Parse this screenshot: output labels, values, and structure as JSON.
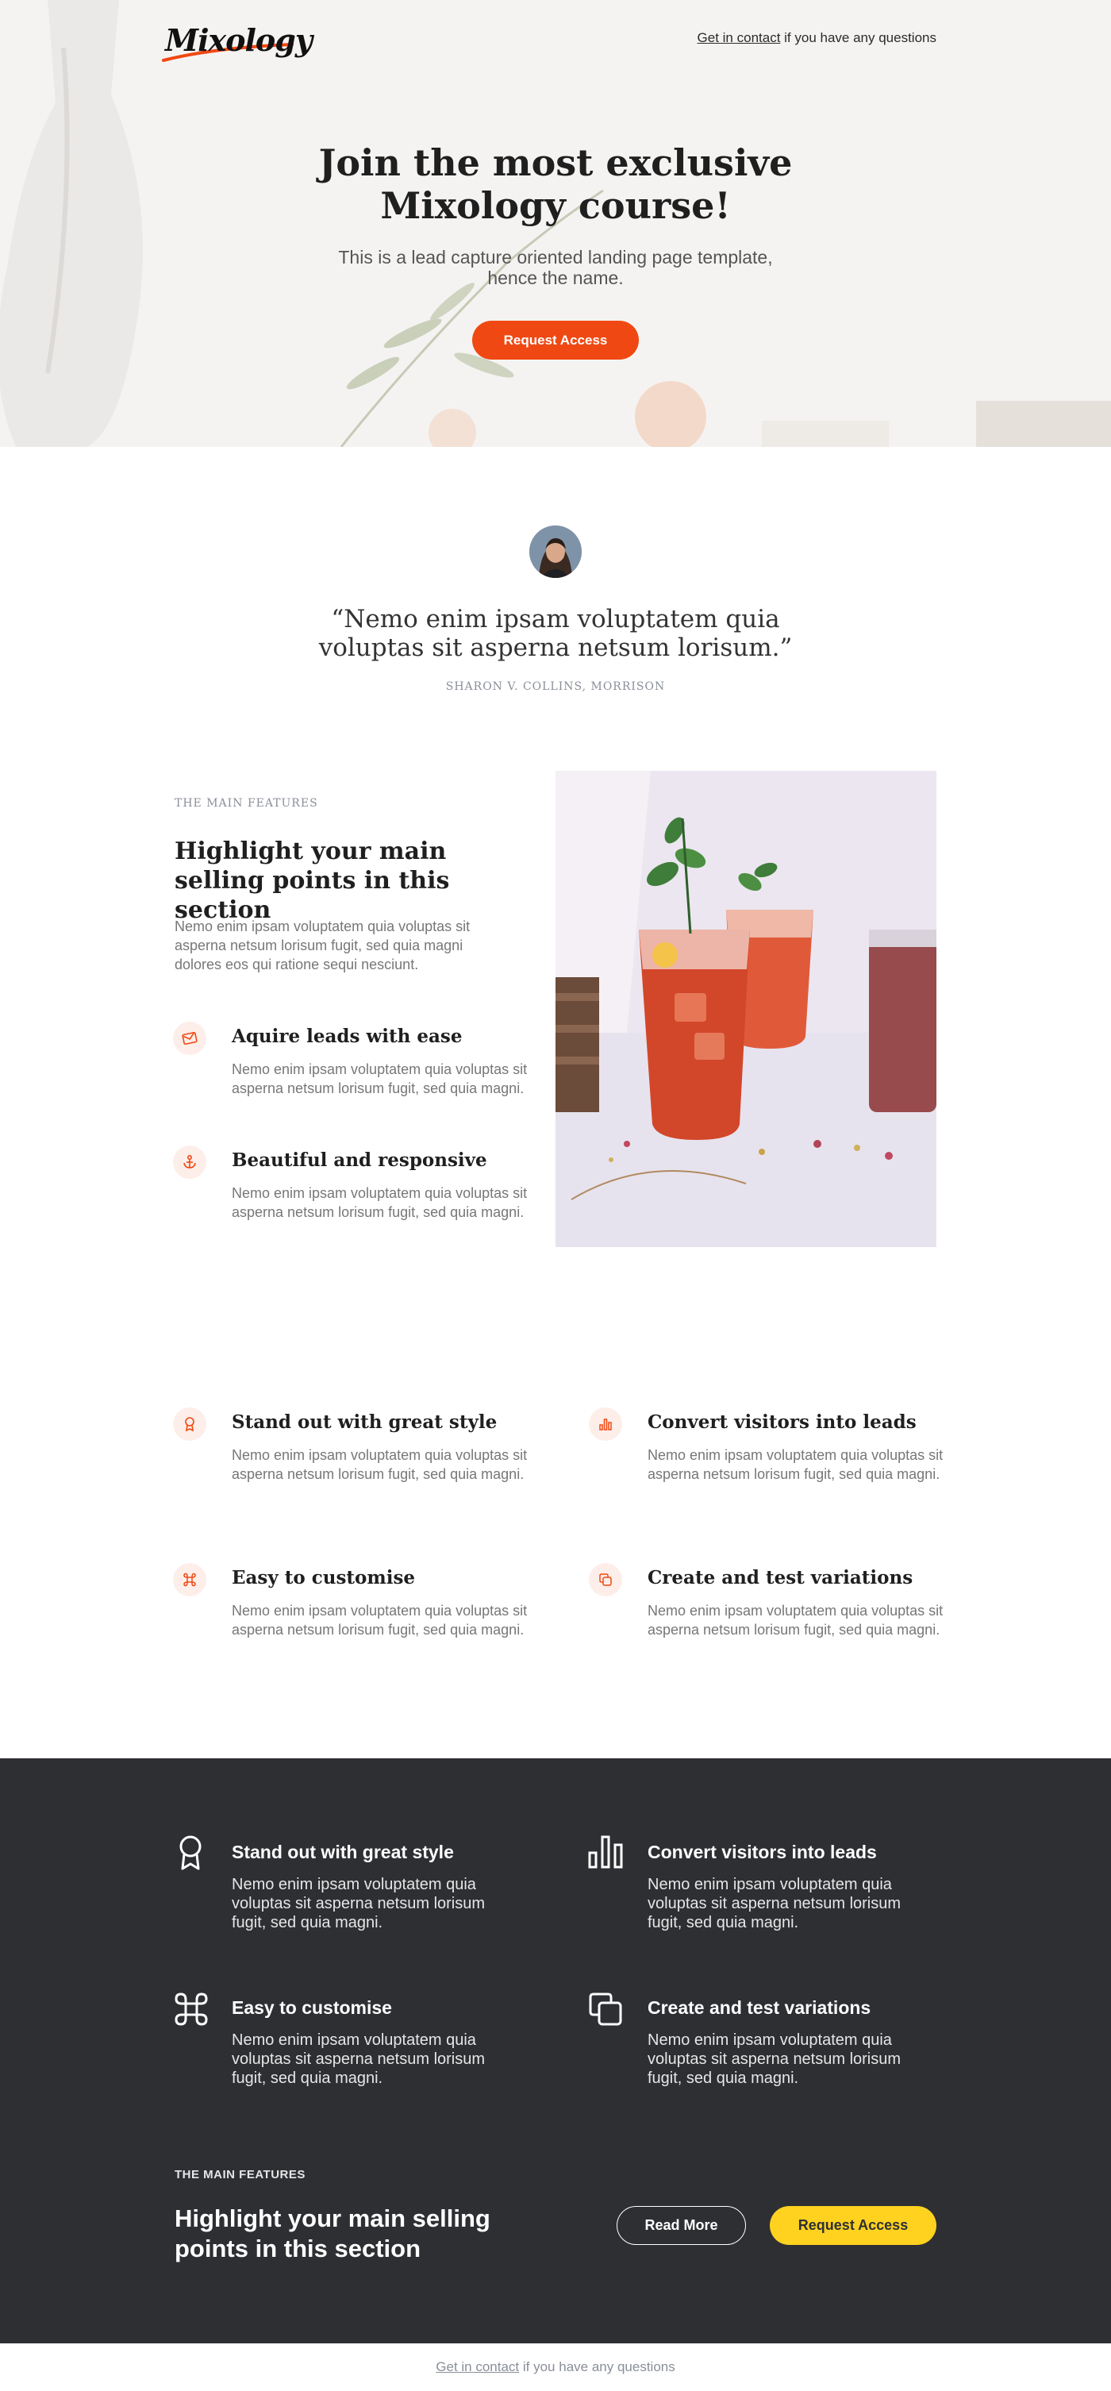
{
  "brand": {
    "logo_text": "Mixology",
    "accent": "#f04812",
    "dark_bg": "#2e2f33",
    "yellow": "#ffd21f"
  },
  "header": {
    "contact_link": "Get in contact",
    "contact_suffix": " if you have any questions"
  },
  "hero": {
    "title": "Join the most exclusive Mixology course!",
    "subtitle": "This is a lead capture oriented landing page template, hence the name.",
    "cta": "Request Access"
  },
  "testimonial": {
    "quote": "“Nemo enim ipsam voluptatem quia voluptas sit asperna netsum lorisum.”",
    "author": "SHARON V. COLLINS, MORRISON"
  },
  "features_main": {
    "eyebrow": "THE MAIN FEATURES",
    "title": "Highlight your main selling points in this section",
    "text": "Nemo enim ipsam voluptatem quia voluptas sit asperna netsum lorisum fugit, sed quia magni dolores eos qui ratione sequi nesciunt.",
    "items": [
      {
        "icon": "mail-icon",
        "title": "Aquire leads with ease",
        "text": "Nemo enim ipsam voluptatem quia voluptas sit asperna netsum lorisum fugit, sed quia magni."
      },
      {
        "icon": "anchor-icon",
        "title": "Beautiful and responsive",
        "text": "Nemo enim ipsam voluptatem quia voluptas sit asperna netsum lorisum fugit, sed quia magni."
      }
    ]
  },
  "features_grid": [
    {
      "icon": "award-icon",
      "title": "Stand out with great style",
      "text": "Nemo enim ipsam voluptatem quia voluptas sit asperna netsum lorisum fugit, sed quia magni."
    },
    {
      "icon": "bar-chart-icon",
      "title": "Convert visitors into leads",
      "text": "Nemo enim ipsam voluptatem quia voluptas sit asperna netsum lorisum fugit, sed quia magni."
    },
    {
      "icon": "command-icon",
      "title": "Easy to customise",
      "text": "Nemo enim ipsam voluptatem quia voluptas sit asperna netsum lorisum fugit, sed quia magni."
    },
    {
      "icon": "copy-icon",
      "title": "Create and test variations",
      "text": "Nemo enim ipsam voluptatem quia voluptas sit asperna netsum lorisum fugit, sed quia magni."
    }
  ],
  "dark_grid": [
    {
      "icon": "award-icon",
      "title": "Stand out with great style",
      "text": "Nemo enim ipsam voluptatem quia voluptas sit asperna netsum lorisum fugit, sed quia magni."
    },
    {
      "icon": "bar-chart-icon",
      "title": "Convert visitors into leads",
      "text": "Nemo enim ipsam voluptatem quia voluptas sit asperna netsum lorisum fugit, sed quia magni."
    },
    {
      "icon": "command-icon",
      "title": "Easy to customise",
      "text": "Nemo enim ipsam voluptatem quia voluptas sit asperna netsum lorisum fugit, sed quia magni."
    },
    {
      "icon": "copy-icon",
      "title": "Create and test variations",
      "text": "Nemo enim ipsam voluptatem quia voluptas sit asperna netsum lorisum fugit, sed quia magni."
    }
  ],
  "dark_cta": {
    "eyebrow": "THE MAIN FEATURES",
    "title": "Highlight your main selling points in this section",
    "read_more": "Read More",
    "request": "Request Access"
  },
  "footer": {
    "contact_link": "Get in contact",
    "contact_suffix": " if you have any questions"
  }
}
